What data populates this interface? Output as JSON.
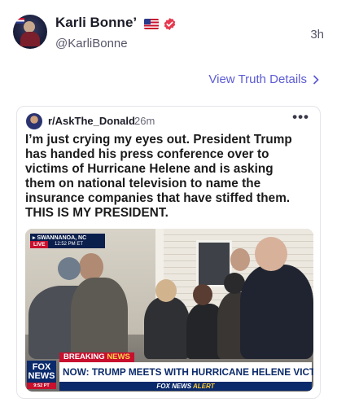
{
  "author": {
    "name": "Karli Bonne’",
    "handle": "@KarliBonne",
    "timestamp": "3h",
    "flag_emoji": "US flag",
    "verified_icon": "verified-badge-icon",
    "verified_color": "#e63950"
  },
  "details_link": {
    "label": "View Truth Details",
    "color": "#5b5bd6"
  },
  "embedded_post": {
    "subreddit": "r/AskThe_Donald",
    "age": "26m",
    "more_label": "•••",
    "lines": [
      "I’m just crying my eyes out. President Trump",
      "has handed his press conference over to",
      "victims of Hurricane Helene and is asking",
      "them on national television to name the",
      "insurance companies that have stiffed them.",
      "THIS IS MY PRESIDENT."
    ]
  },
  "tv_graphic": {
    "location": "▸ SWANNANOA, NC",
    "live": "LIVE",
    "clock": "12:52 PM ET",
    "breaking_prefix": "BREAKING",
    "breaking_suffix": "NEWS",
    "headline": "NOW: TRUMP MEETS WITH HURRICANE HELENE VICTIMS",
    "strap_prefix": "FOX NEWS",
    "strap_suffix": "ALERT",
    "logo_word_1": "FOX",
    "logo_word_2": "NEWS",
    "logo_time": "9:52 PT"
  }
}
